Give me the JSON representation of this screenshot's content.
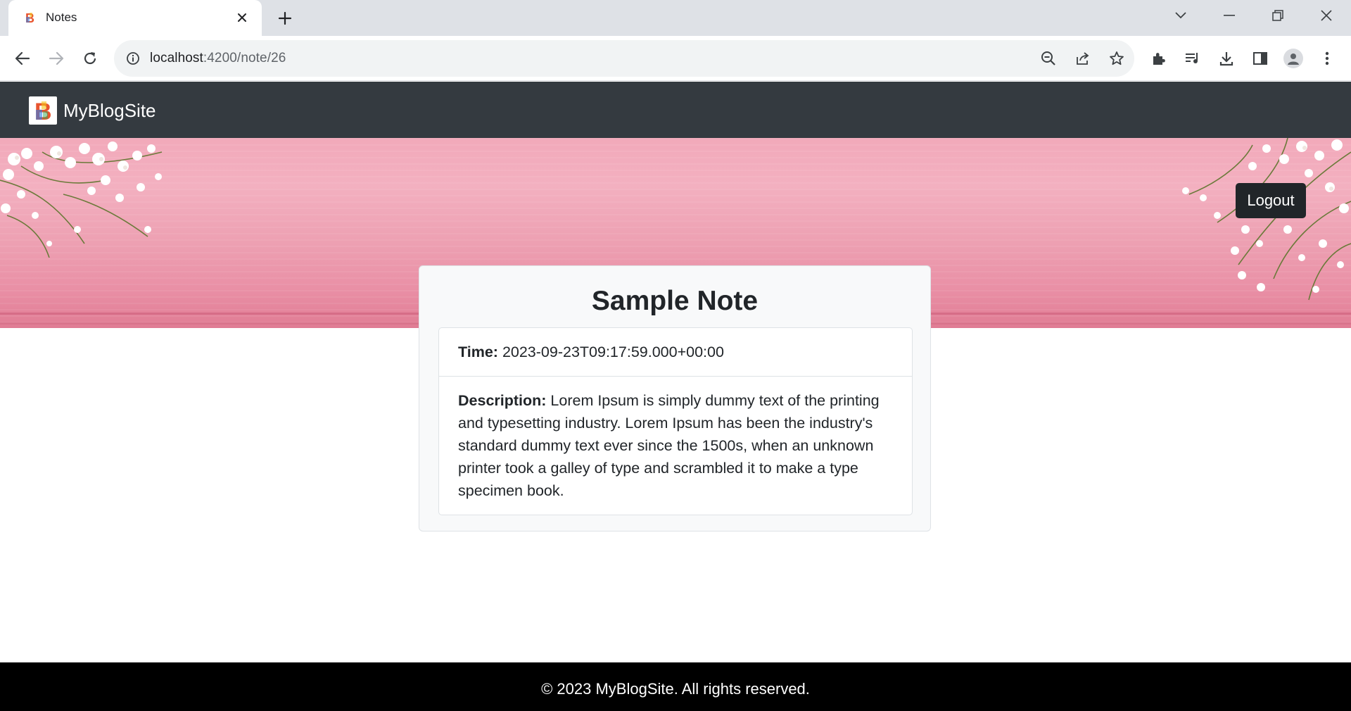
{
  "browser": {
    "tab_title": "Notes",
    "url_host": "localhost",
    "url_path": ":4200/note/26"
  },
  "navbar": {
    "brand": "MyBlogSite"
  },
  "hero": {
    "logout_label": "Logout"
  },
  "note": {
    "title": "Sample Note",
    "time_label": "Time:",
    "time_value": "2023-09-23T09:17:59.000+00:00",
    "description_label": "Description:",
    "description_value": "Lorem Ipsum is simply dummy text of the printing and typesetting industry. Lorem Ipsum has been the industry's standard dummy text ever since the 1500s, when an unknown printer took a galley of type and scrambled it to make a type specimen book."
  },
  "footer": {
    "text": "© 2023 MyBlogSite. All rights reserved."
  },
  "colors": {
    "navbar": "#343a40",
    "hero_pink": "#f2a9ba",
    "logout_bg": "#212529",
    "footer": "#000000"
  }
}
